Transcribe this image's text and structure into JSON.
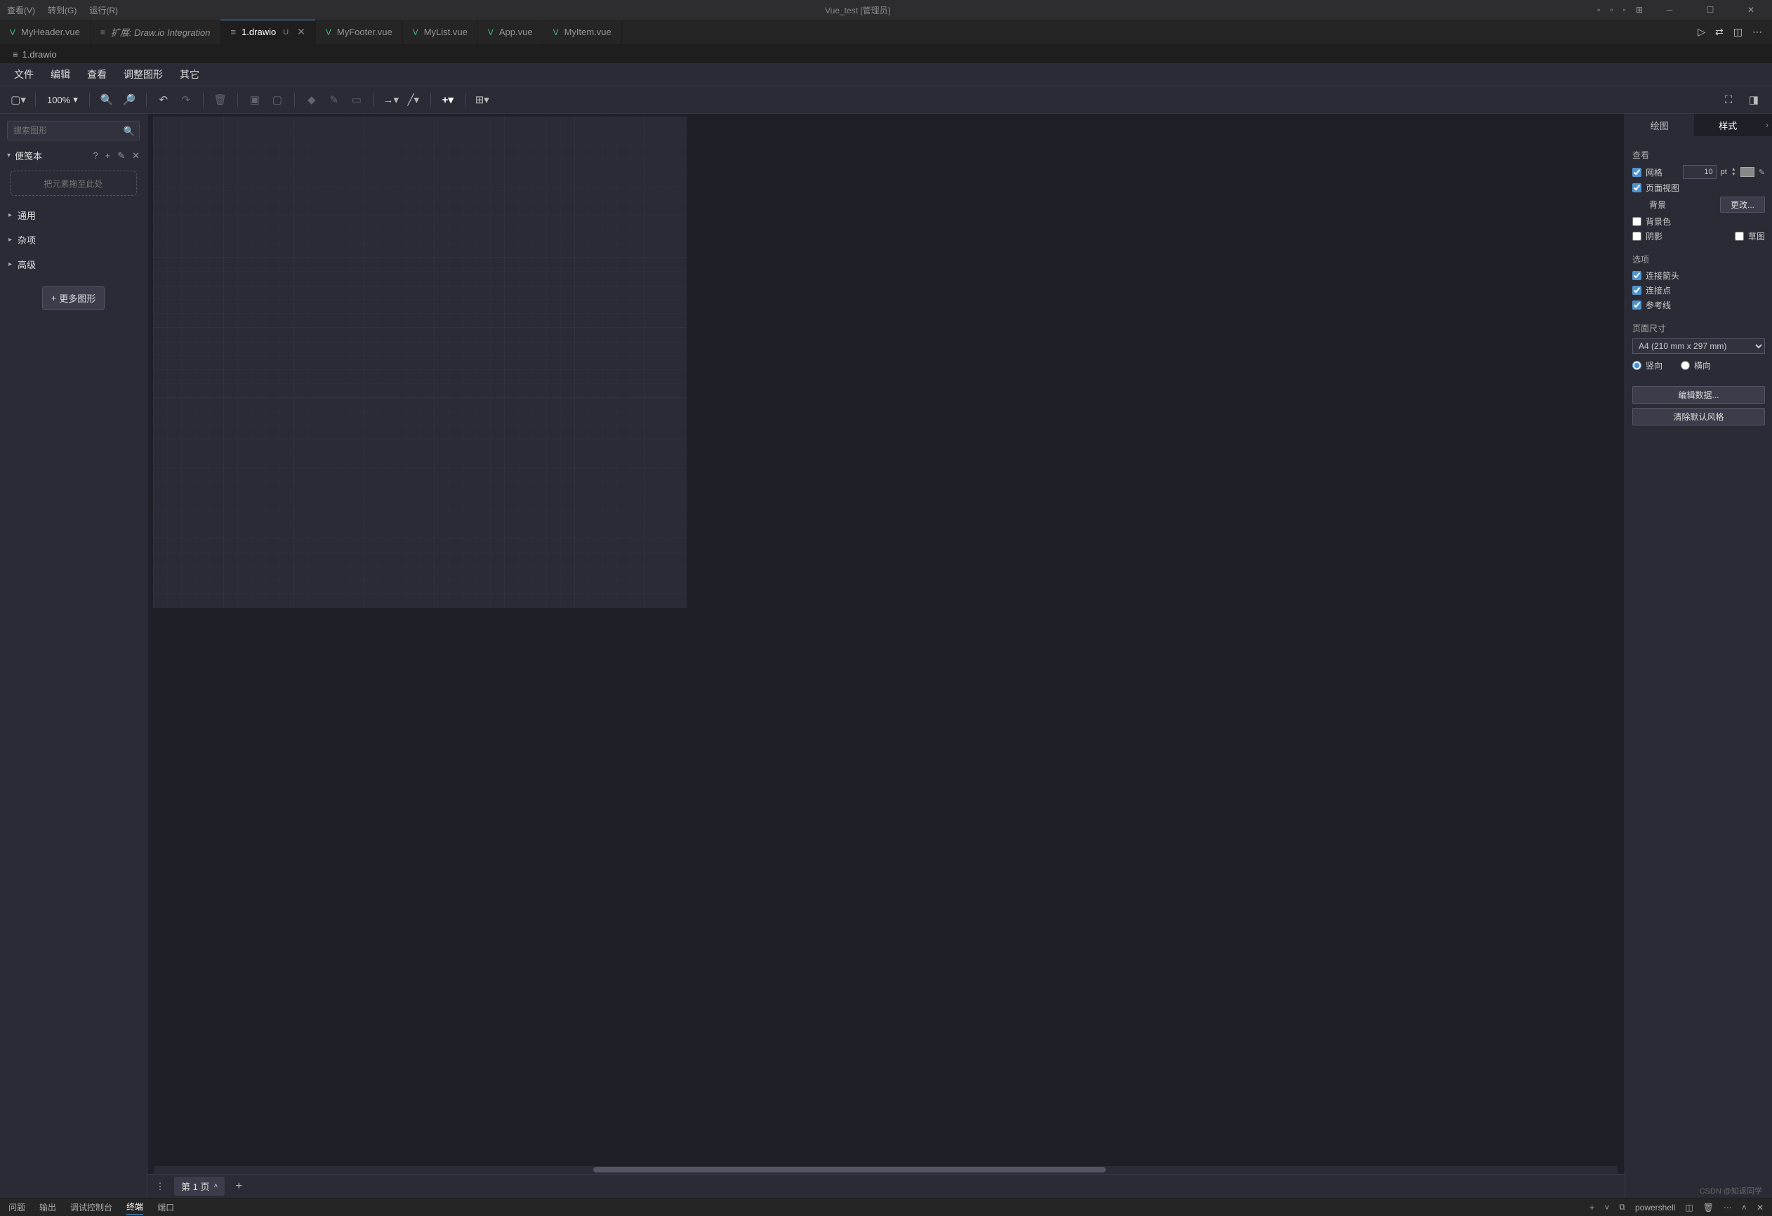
{
  "topMenu": {
    "view": "查看(V)",
    "record": "转到(G)",
    "run": "运行(R)"
  },
  "windowTitle": "Vue_test [管理员]",
  "editorTabs": [
    {
      "label": "MyHeader.vue",
      "type": "vue"
    },
    {
      "label": "扩展: Draw.io Integration",
      "type": "ext"
    },
    {
      "label": "1.drawio",
      "type": "drawio",
      "active": true,
      "modified": "U"
    },
    {
      "label": "MyFooter.vue",
      "type": "vue"
    },
    {
      "label": "MyList.vue",
      "type": "vue"
    },
    {
      "label": "App.vue",
      "type": "vue"
    },
    {
      "label": "MyItem.vue",
      "type": "vue"
    }
  ],
  "breadcrumb": {
    "icon": "≡",
    "file": "1.drawio"
  },
  "drawioMenu": [
    "文件",
    "编辑",
    "查看",
    "调整图形",
    "其它"
  ],
  "toolbar": {
    "zoom": "100%"
  },
  "leftPanel": {
    "searchPlaceholder": "搜索图形",
    "scratchpad": "便笺本",
    "dropZone": "把元素拖至此处",
    "categories": [
      "通用",
      "杂项",
      "高级"
    ],
    "moreShapes": "更多图形"
  },
  "rightPanel": {
    "tabs": {
      "diagram": "绘图",
      "style": "样式"
    },
    "viewTitle": "查看",
    "grid": "网格",
    "gridSize": "10",
    "gridUnit": "pt",
    "pageView": "页面视图",
    "background": "背景",
    "changeBtn": "更改...",
    "bgColor": "背景色",
    "shadow": "阴影",
    "sketch": "草图",
    "optionsTitle": "选项",
    "connectArrows": "连接箭头",
    "connectPoints": "连接点",
    "guides": "参考线",
    "pageSizeTitle": "页面尺寸",
    "pageSize": "A4 (210 mm x 297 mm)",
    "portrait": "竖向",
    "landscape": "横向",
    "editData": "编辑数据...",
    "clearStyle": "清除默认风格"
  },
  "pageTabs": {
    "page1": "第 1 页"
  },
  "statusBar": {
    "items": [
      "问题",
      "输出",
      "调试控制台",
      "终端",
      "端口"
    ],
    "activeIndex": 3,
    "powershell": "powershell"
  },
  "watermark": "CSDN @知返同学"
}
